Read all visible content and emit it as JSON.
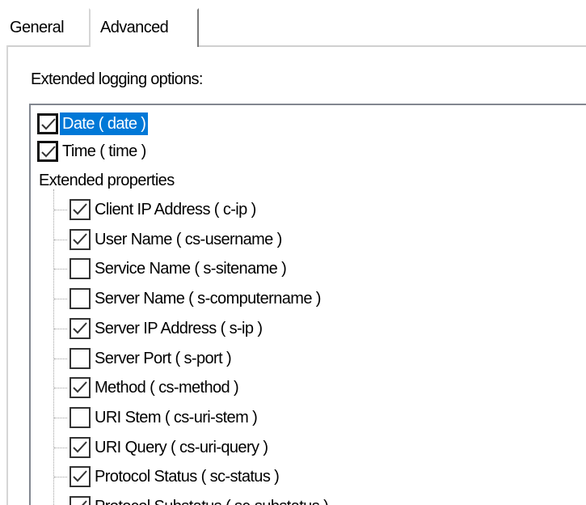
{
  "tabs": {
    "general": "General",
    "advanced": "Advanced"
  },
  "options_label": "Extended logging options:",
  "tree": {
    "top_items": [
      {
        "label": "Date ( date )",
        "checked": true,
        "selected": true
      },
      {
        "label": "Time ( time )",
        "checked": true,
        "selected": false
      }
    ],
    "group_label": "Extended properties",
    "children": [
      {
        "label": "Client IP Address ( c-ip )",
        "checked": true
      },
      {
        "label": "User Name ( cs-username )",
        "checked": true
      },
      {
        "label": "Service Name ( s-sitename )",
        "checked": false
      },
      {
        "label": "Server Name ( s-computername )",
        "checked": false
      },
      {
        "label": "Server IP Address ( s-ip )",
        "checked": true
      },
      {
        "label": "Server Port ( s-port )",
        "checked": false
      },
      {
        "label": "Method ( cs-method )",
        "checked": true
      },
      {
        "label": "URI Stem ( cs-uri-stem )",
        "checked": false
      },
      {
        "label": "URI Query ( cs-uri-query )",
        "checked": true
      },
      {
        "label": "Protocol Status ( sc-status )",
        "checked": true
      },
      {
        "label": "Protocol Substatus ( sc-substatus )",
        "checked": true
      }
    ]
  },
  "colors": {
    "selection": "#0078d7",
    "check": "#333333"
  }
}
